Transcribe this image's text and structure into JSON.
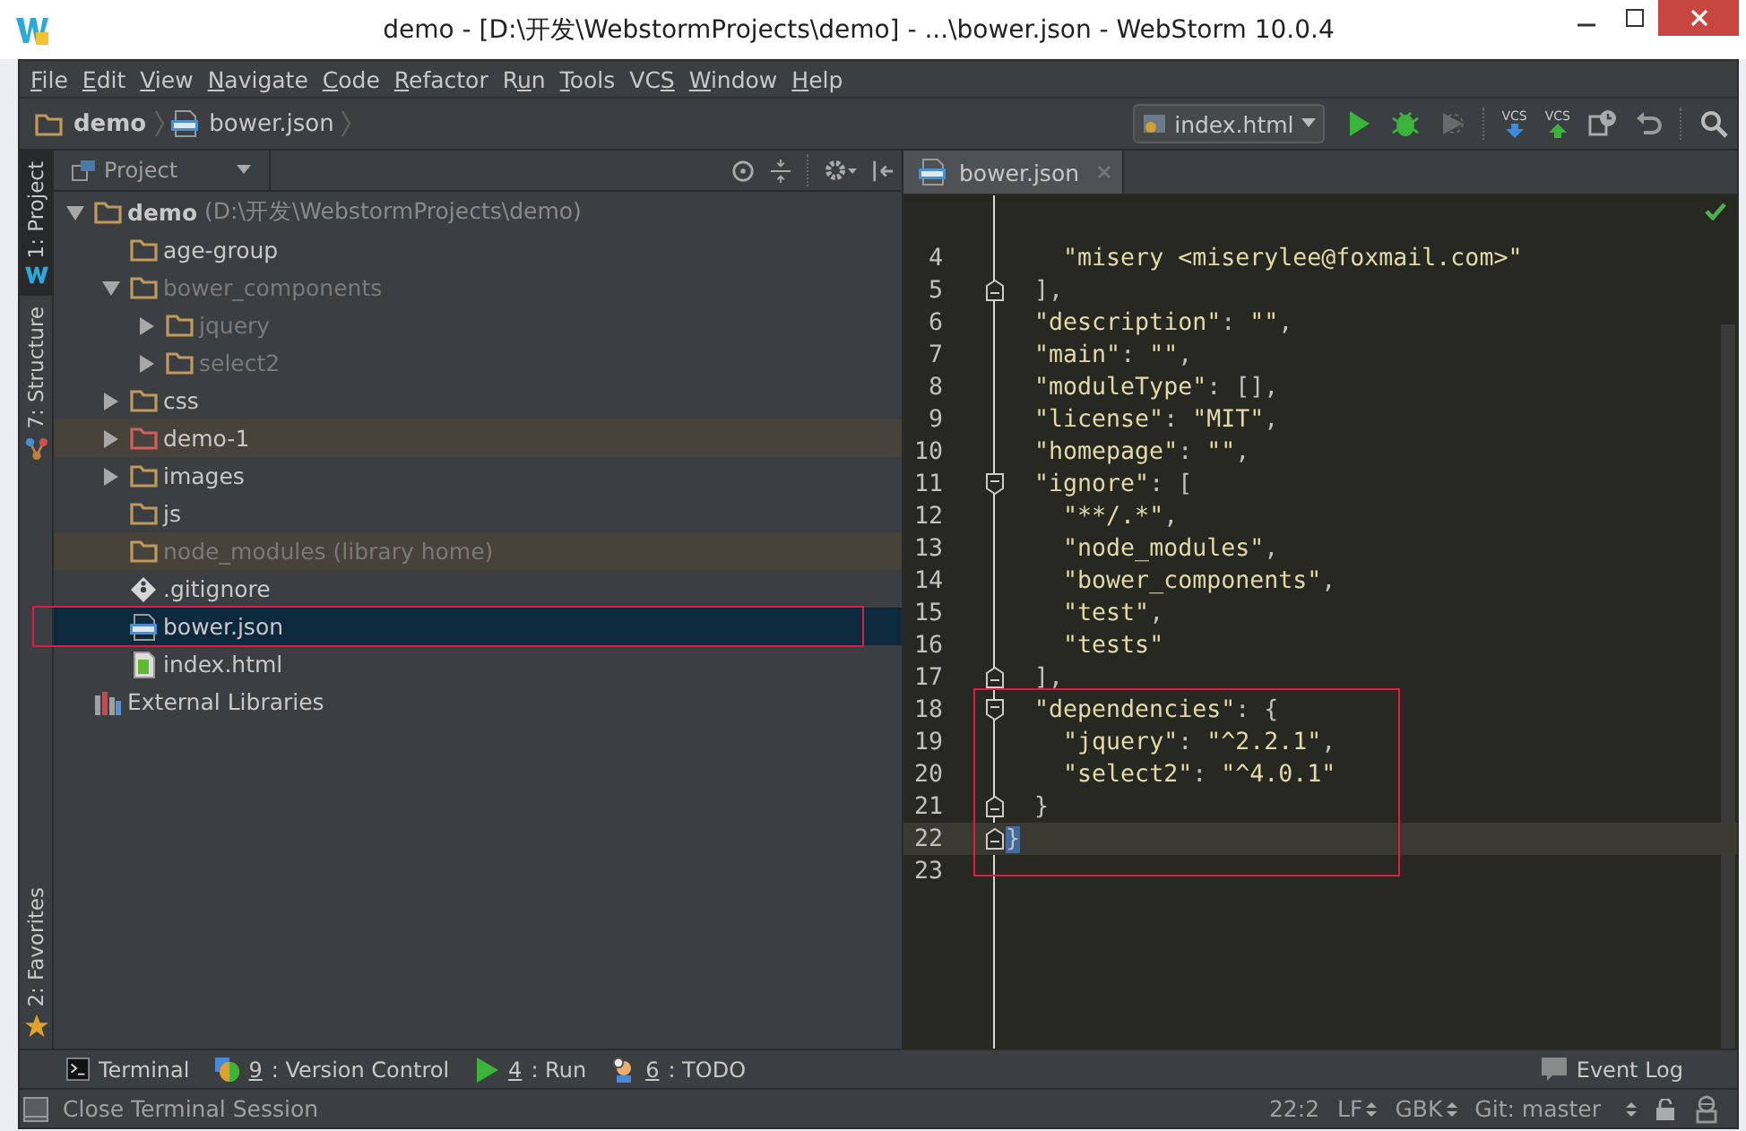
{
  "window": {
    "title": "demo - [D:\\开发\\WebstormProjects\\demo] - ...\\bower.json - WebStorm 10.0.4"
  },
  "menu": [
    {
      "key": "F",
      "post": "ile"
    },
    {
      "key": "E",
      "post": "dit"
    },
    {
      "key": "V",
      "post": "iew"
    },
    {
      "key": "N",
      "post": "avigate"
    },
    {
      "key": "C",
      "post": "ode"
    },
    {
      "key": "R",
      "post": "efactor"
    },
    {
      "pre": "R",
      "key": "u",
      "post": "n"
    },
    {
      "key": "T",
      "post": "ools"
    },
    {
      "pre": "VC",
      "key": "S"
    },
    {
      "key": "W",
      "post": "indow"
    },
    {
      "key": "H",
      "post": "elp"
    }
  ],
  "breadcrumb": [
    {
      "kind": "folder",
      "label": "demo",
      "bold": true
    },
    {
      "kind": "json",
      "label": "bower.json",
      "bold": false
    }
  ],
  "run_config": {
    "label": "index.html"
  },
  "toolbar": [
    {
      "kind": "run",
      "disabled": false
    },
    {
      "kind": "debug",
      "disabled": false
    },
    {
      "kind": "coverage",
      "disabled": true
    },
    {
      "kind": "vcs-update",
      "label": "VCS",
      "disabled": false
    },
    {
      "kind": "vcs-commit",
      "label": "VCS",
      "disabled": false
    },
    {
      "kind": "history",
      "disabled": false
    },
    {
      "kind": "revert",
      "disabled": false
    },
    {
      "kind": "search",
      "disabled": false
    }
  ],
  "side_tabs": [
    {
      "kind": "project",
      "label": "1: Project",
      "selected": true
    },
    {
      "kind": "structure",
      "label": "7: Structure",
      "selected": false
    }
  ],
  "favorites_tab": {
    "label": "2: Favorites"
  },
  "project_panel": {
    "title": "Project",
    "tree": [
      {
        "kind": "folder",
        "label": "demo",
        "suffix": "(D:\\开发\\WebstormProjects\\demo)",
        "expanded": true,
        "dimmed": false,
        "selected": false,
        "children": [
          {
            "kind": "folder",
            "label": "age-group",
            "dimmed": false,
            "selected": false
          },
          {
            "kind": "folder",
            "label": "bower_components",
            "expanded": true,
            "dimmed": true,
            "selected": false,
            "children": [
              {
                "kind": "folder",
                "label": "jquery",
                "expanded": false,
                "dimmed": true,
                "selected": false
              },
              {
                "kind": "folder",
                "label": "select2",
                "expanded": false,
                "dimmed": true,
                "selected": false
              }
            ]
          },
          {
            "kind": "folder",
            "label": "css",
            "expanded": false,
            "dimmed": false,
            "selected": false
          },
          {
            "kind": "module",
            "label": "demo-1",
            "expanded": false,
            "dimmed": false,
            "selected": false
          },
          {
            "kind": "folder",
            "label": "images",
            "expanded": false,
            "dimmed": false,
            "selected": false
          },
          {
            "kind": "folder",
            "label": "js",
            "dimmed": false,
            "selected": false
          },
          {
            "kind": "library",
            "label": "node_modules (library home)",
            "dimmed": true,
            "selected": false
          },
          {
            "kind": "git",
            "label": ".gitignore",
            "dimmed": false,
            "selected": false
          },
          {
            "kind": "json",
            "label": "bower.json",
            "dimmed": false,
            "selected": true,
            "outlined": true
          },
          {
            "kind": "html",
            "label": "index.html",
            "dimmed": false,
            "selected": false
          }
        ]
      },
      {
        "kind": "libraries",
        "label": "External Libraries",
        "dimmed": false,
        "selected": false
      }
    ]
  },
  "editor": {
    "tab": {
      "label": "bower.json"
    },
    "blocks": [
      {
        "outlined": false,
        "lines": [
          {
            "n": "4",
            "kind": "plain",
            "text": "    \"misery <miserylee@foxmail.com>\""
          },
          {
            "n": "5",
            "kind": "fold-end",
            "text": "  ],"
          },
          {
            "n": "6",
            "kind": "plain",
            "text": "  \"description\": \"\","
          },
          {
            "n": "7",
            "kind": "plain",
            "text": "  \"main\": \"\","
          },
          {
            "n": "8",
            "kind": "plain",
            "text": "  \"moduleType\": [],"
          },
          {
            "n": "9",
            "kind": "plain",
            "text": "  \"license\": \"MIT\","
          },
          {
            "n": "10",
            "kind": "plain",
            "text": "  \"homepage\": \"\","
          },
          {
            "n": "11",
            "kind": "fold-start",
            "text": "  \"ignore\": ["
          },
          {
            "n": "12",
            "kind": "plain",
            "text": "    \"**/.*\","
          },
          {
            "n": "13",
            "kind": "plain",
            "text": "    \"node_modules\","
          },
          {
            "n": "14",
            "kind": "plain",
            "text": "    \"bower_components\","
          },
          {
            "n": "15",
            "kind": "plain",
            "text": "    \"test\","
          },
          {
            "n": "16",
            "kind": "plain",
            "text": "    \"tests\""
          },
          {
            "n": "17",
            "kind": "fold-end",
            "text": "  ],"
          }
        ]
      },
      {
        "outlined": true,
        "lines": [
          {
            "n": "18",
            "kind": "fold-start",
            "text": "  \"dependencies\": {"
          },
          {
            "n": "19",
            "kind": "plain",
            "text": "    \"jquery\": \"^2.2.1\","
          },
          {
            "n": "20",
            "kind": "plain",
            "text": "    \"select2\": \"^4.0.1\""
          },
          {
            "n": "21",
            "kind": "fold-end",
            "text": "  }"
          },
          {
            "n": "22",
            "kind": "fold-end",
            "text": "}",
            "current": true,
            "matched": true
          },
          {
            "n": "23",
            "kind": "plain"
          }
        ]
      }
    ]
  },
  "tool_tabs": [
    {
      "kind": "terminal",
      "pre": "Terminal"
    },
    {
      "kind": "vcs",
      "key": "9",
      "post": ": Version Control"
    },
    {
      "kind": "run",
      "key": "4",
      "post": ": Run"
    },
    {
      "kind": "todo",
      "key": "6",
      "post": ": TODO"
    }
  ],
  "event_log": {
    "label": "Event Log"
  },
  "status_bar": {
    "message": "Close Terminal Session",
    "position": "22:2",
    "line_separator": "LF",
    "encoding": "GBK",
    "vcs_branch": "Git: master"
  }
}
